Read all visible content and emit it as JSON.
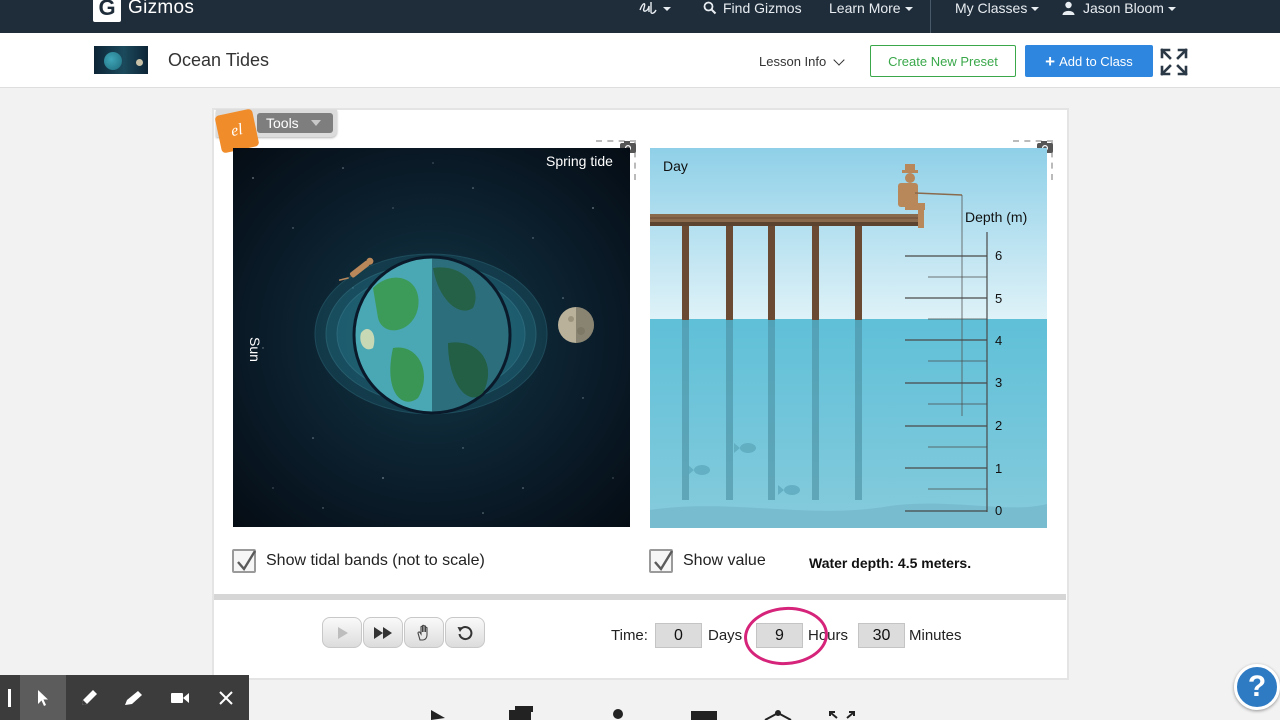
{
  "nav": {
    "logo_letter": "G",
    "brand": "Gizmos",
    "find": "Find Gizmos",
    "learn": "Learn More",
    "classes": "My Classes",
    "user": "Jason Bloom"
  },
  "header": {
    "title": "Ocean Tides",
    "lesson_info": "Lesson Info",
    "create_preset": "Create New Preset",
    "add_to_class": "Add to Class"
  },
  "tools": {
    "label": "Tools",
    "badge": "el"
  },
  "space_view": {
    "tide_label": "Spring tide",
    "sun_label": "Sun"
  },
  "ocean_view": {
    "period_label": "Day",
    "axis_label": "Depth (m)",
    "ticks": [
      "6",
      "5",
      "4",
      "3",
      "2",
      "1",
      "0"
    ]
  },
  "options": {
    "tidal_bands_label": "Show tidal bands (not to scale)",
    "tidal_bands_checked": true,
    "show_value_label": "Show value",
    "show_value_checked": true,
    "water_depth_text": "Water depth: 4.5 meters."
  },
  "time": {
    "label": "Time:",
    "days_value": "0",
    "days_unit": "Days",
    "hours_value": "9",
    "hours_unit": "Hours",
    "minutes_value": "30",
    "minutes_unit": "Minutes"
  },
  "colors": {
    "nav_bg": "#1f2d3a",
    "accent_blue": "#2e86de",
    "accent_green": "#3aa84a",
    "annotation_circle": "#d5247a"
  },
  "help": "?"
}
